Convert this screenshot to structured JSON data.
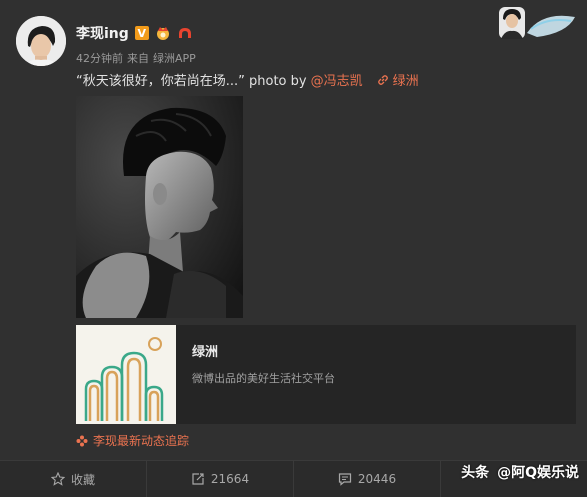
{
  "user": {
    "name": "李现ing",
    "vip_label": "V"
  },
  "meta": {
    "time": "42分钟前",
    "source_prefix": "来自",
    "source": "绿洲APP"
  },
  "post": {
    "text": "“秋天该很好，你若尚在场...” photo by",
    "mention": "@冯志凯",
    "location": "绿洲"
  },
  "link_card": {
    "title": "绿洲",
    "description": "微博出品的美好生活社交平台"
  },
  "track_link": "李现最新动态追踪",
  "actions": {
    "favorite_label": "收藏",
    "repost_count": "21664",
    "comment_count": "20446"
  },
  "watermark": {
    "part1": "头条",
    "part2": "@阿Q娱乐说"
  },
  "colors": {
    "background": "#303030",
    "accent": "#eb7350",
    "vip": "#f29b1a"
  }
}
